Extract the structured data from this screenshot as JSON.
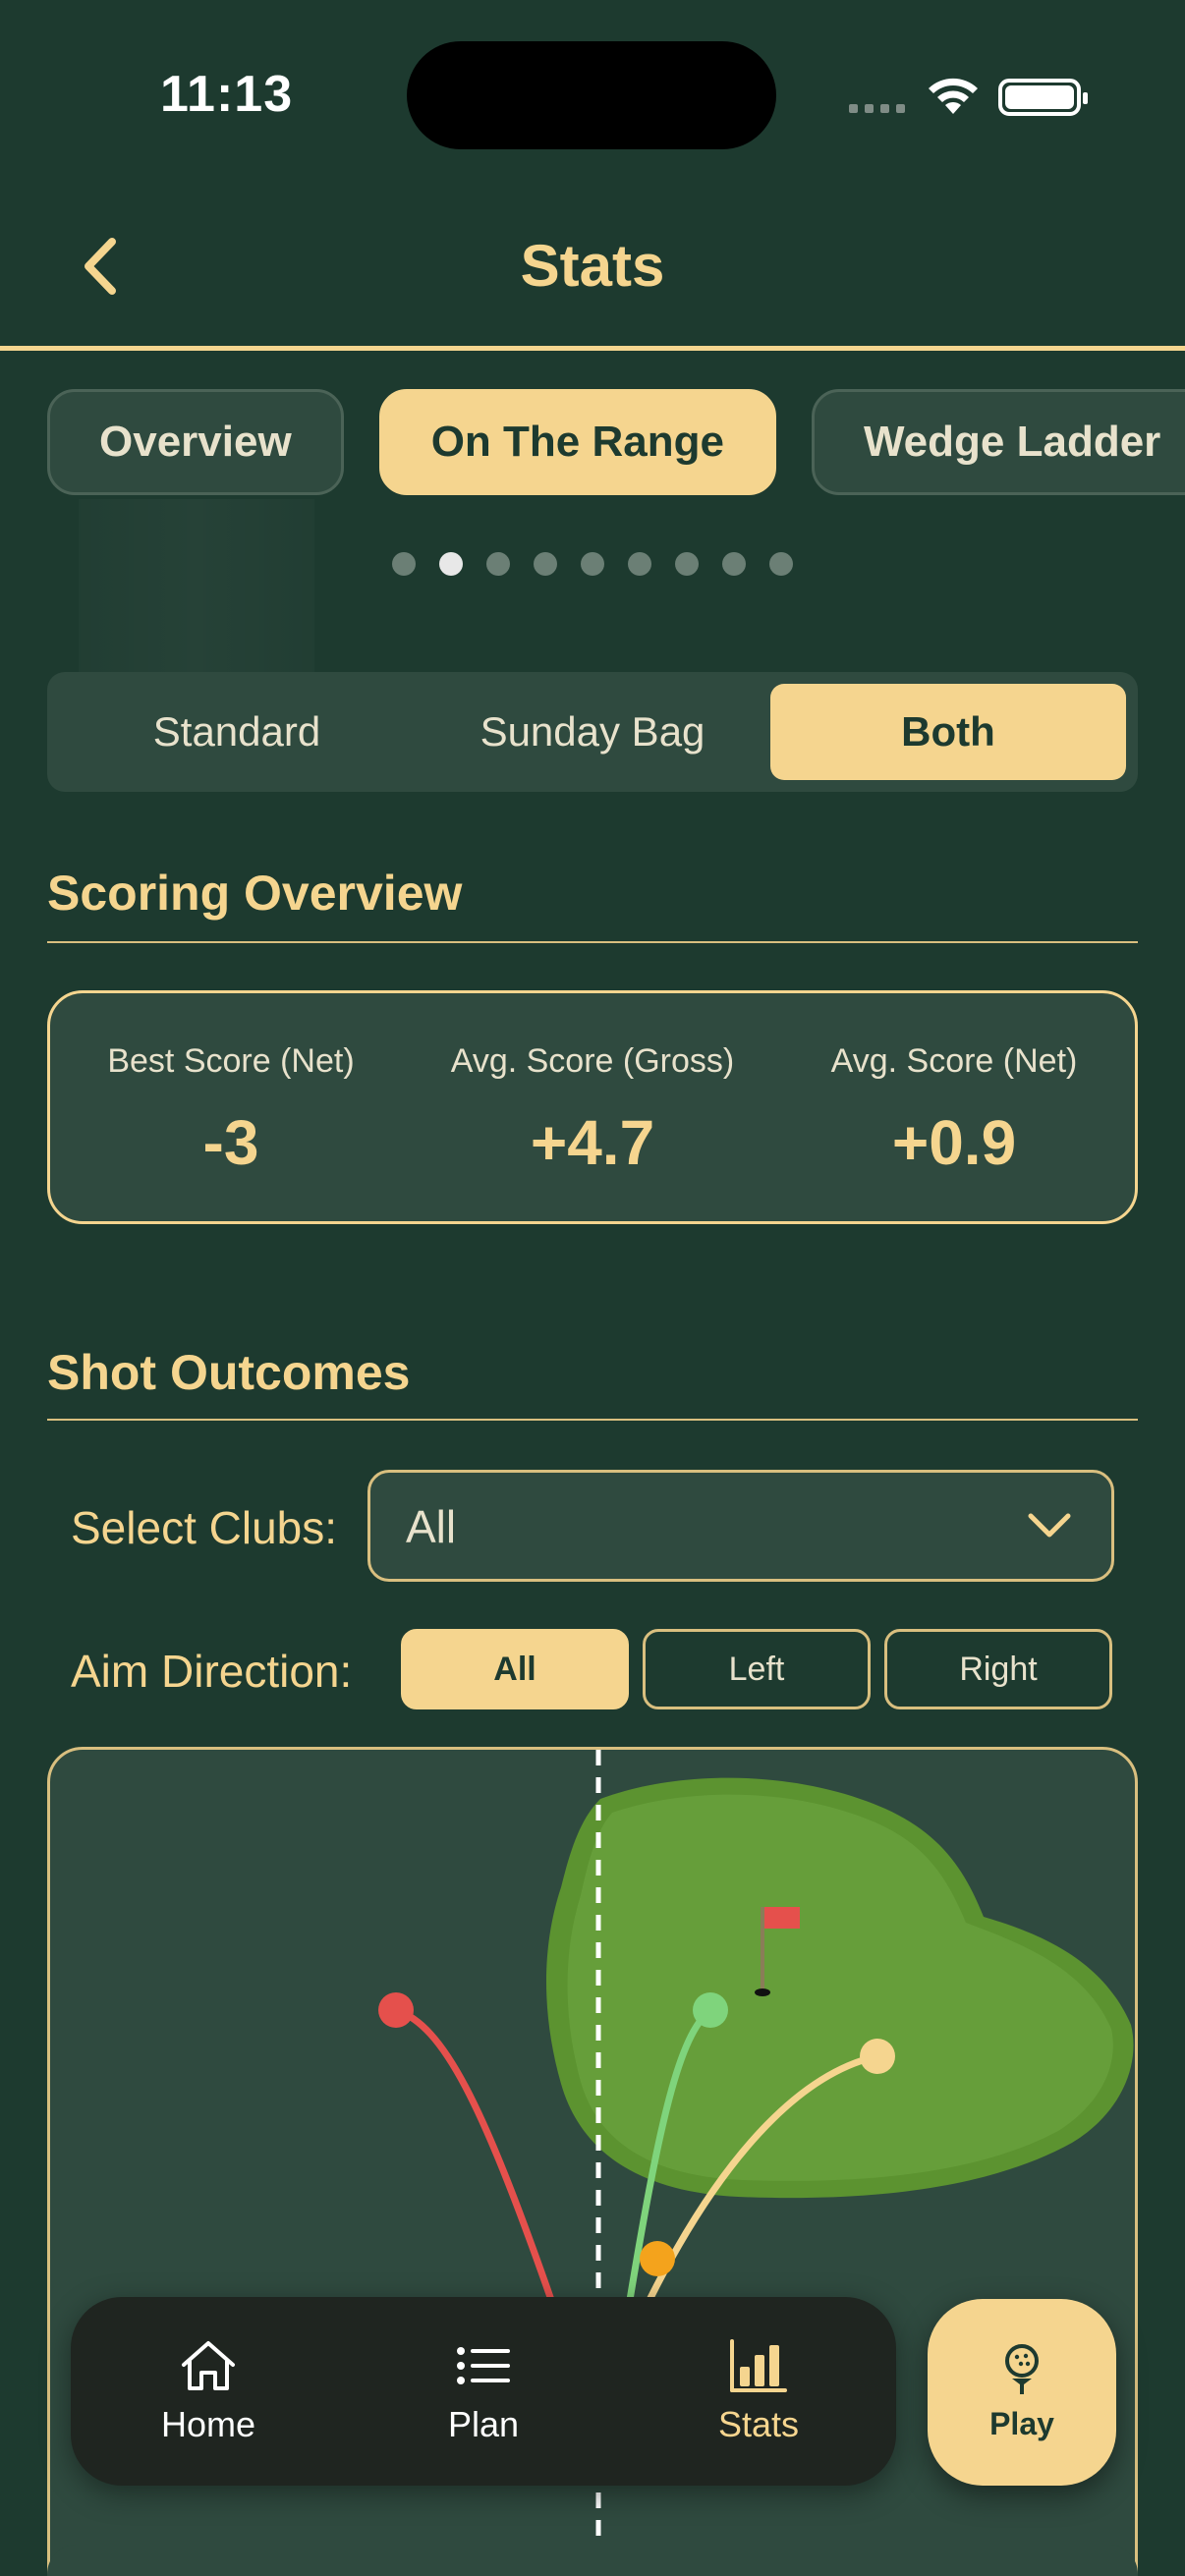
{
  "status_bar": {
    "time": "11:13"
  },
  "nav": {
    "title": "Stats"
  },
  "tabs": [
    {
      "label": "Overview",
      "active": false
    },
    {
      "label": "On The Range",
      "active": true
    },
    {
      "label": "Wedge Ladder",
      "active": false
    }
  ],
  "page_dots": {
    "count": 9,
    "active_index": 1
  },
  "bag_filter": {
    "options": [
      "Standard",
      "Sunday Bag",
      "Both"
    ],
    "selected": "Both"
  },
  "scoring_overview": {
    "title": "Scoring Overview",
    "stats": [
      {
        "label": "Best Score (Net)",
        "value": "-3"
      },
      {
        "label": "Avg. Score (Gross)",
        "value": "+4.7"
      },
      {
        "label": "Avg. Score (Net)",
        "value": "+0.9"
      }
    ]
  },
  "shot_outcomes": {
    "title": "Shot Outcomes",
    "select_clubs_label": "Select Clubs:",
    "select_clubs_value": "All",
    "aim_direction_label": "Aim Direction:",
    "aim_options": [
      "All",
      "Left",
      "Right"
    ],
    "aim_selected": "All",
    "shot_colors": [
      "#e5504c",
      "#7fd47c",
      "#f5d58f",
      "#f4a31c"
    ],
    "green_color": "#629a35",
    "flag_color": "#e5504c"
  },
  "tabbar": {
    "items": [
      {
        "label": "Home",
        "icon": "home-icon",
        "active": false
      },
      {
        "label": "Plan",
        "icon": "list-icon",
        "active": false
      },
      {
        "label": "Stats",
        "icon": "bar-chart-icon",
        "active": true
      }
    ],
    "play_label": "Play"
  },
  "colors": {
    "background": "#1d3a2f",
    "accent": "#f5d58f",
    "card": "#2f4a3f"
  }
}
